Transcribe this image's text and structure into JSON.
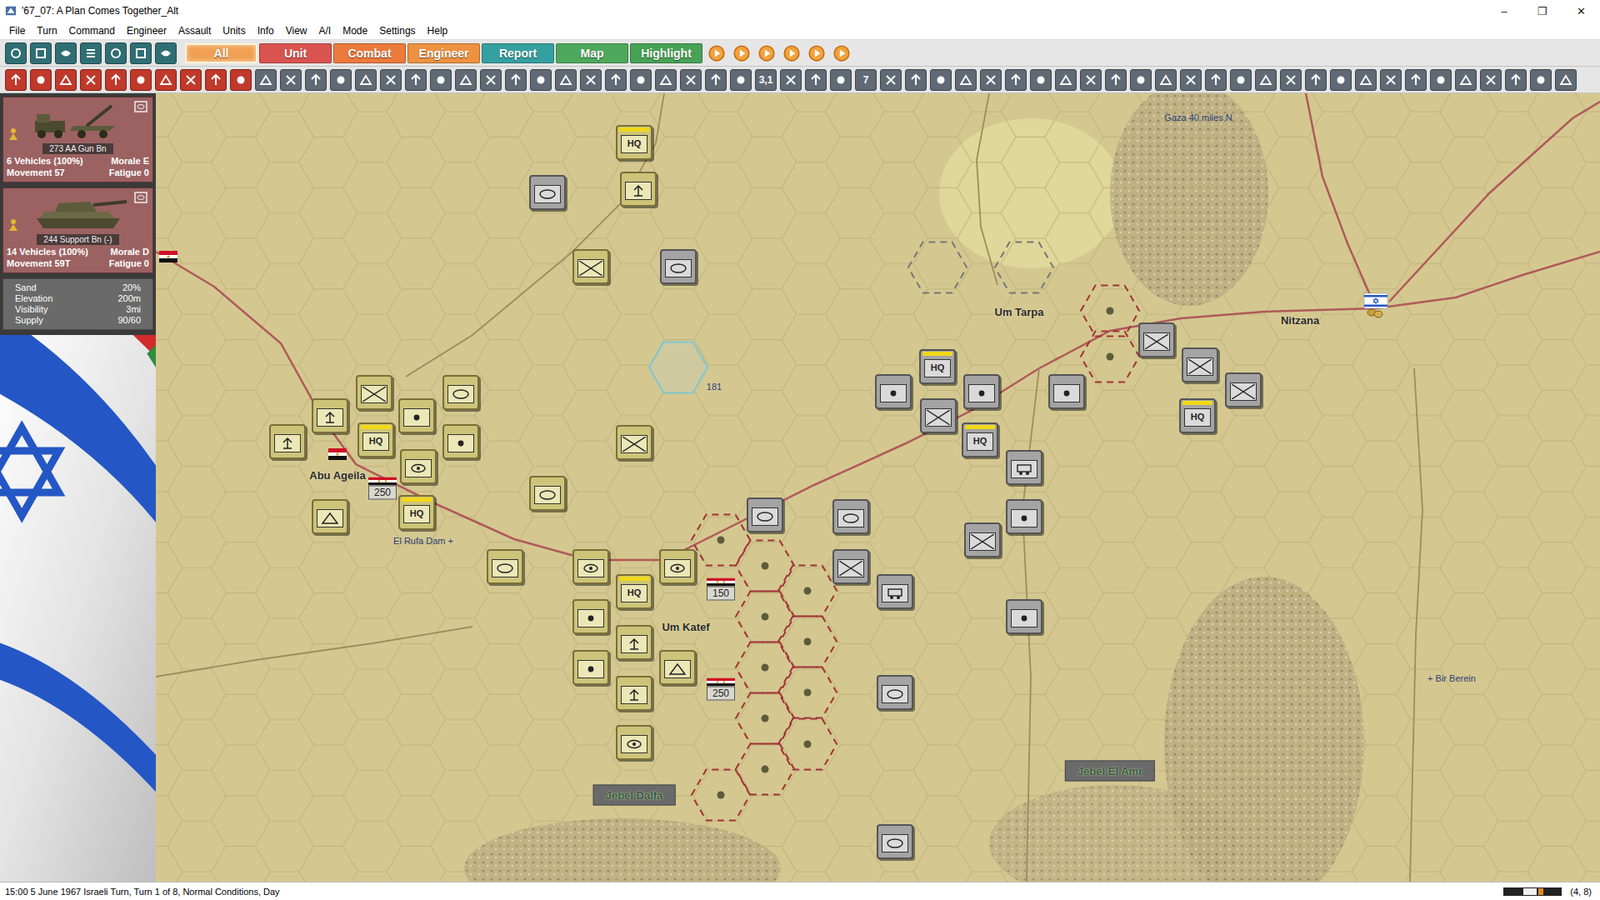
{
  "window": {
    "title": "'67_07: A Plan Comes Together_Alt",
    "controls": [
      "–",
      "❐",
      "✕"
    ]
  },
  "menu": [
    "File",
    "Turn",
    "Command",
    "Engineer",
    "Assault",
    "Units",
    "Info",
    "View",
    "A/I",
    "Mode",
    "Settings",
    "Help"
  ],
  "toolbar_top": {
    "icons": [
      {
        "kind": "icon"
      },
      {
        "kind": "icon"
      },
      {
        "kind": "icon"
      },
      {
        "kind": "icon"
      },
      {
        "kind": "icon"
      },
      {
        "kind": "icon"
      },
      {
        "kind": "icon"
      }
    ],
    "tabs": [
      {
        "label": "All",
        "selected": true,
        "color": "#f0a050"
      },
      {
        "label": "Unit",
        "selected": false,
        "color": "#d9534f"
      },
      {
        "label": "Combat",
        "selected": false,
        "color": "#ec7a3c"
      },
      {
        "label": "Engineer",
        "selected": false,
        "color": "#ee9240"
      },
      {
        "label": "Report",
        "selected": false,
        "color": "#35a0a0"
      },
      {
        "label": "Map",
        "selected": false,
        "color": "#4ea85c"
      },
      {
        "label": "Highlight",
        "selected": false,
        "color": "#47a256"
      }
    ],
    "playback": [
      {
        "kind": "icon"
      },
      {
        "kind": "icon"
      },
      {
        "kind": "icon"
      },
      {
        "kind": "icon"
      },
      {
        "kind": "icon"
      },
      {
        "kind": "icon"
      }
    ]
  },
  "toolbar_bottom": [
    {
      "kind": "icon"
    },
    {
      "kind": "icon"
    },
    {
      "kind": "icon"
    },
    {
      "kind": "icon"
    },
    {
      "kind": "icon"
    },
    {
      "kind": "icon"
    },
    {
      "kind": "icon"
    },
    {
      "kind": "icon"
    },
    {
      "kind": "icon"
    },
    {
      "kind": "icon"
    },
    {
      "kind": "icon"
    },
    {
      "kind": "icon"
    },
    {
      "kind": "icon"
    },
    {
      "kind": "icon"
    },
    {
      "kind": "icon"
    },
    {
      "kind": "icon"
    },
    {
      "kind": "icon"
    },
    {
      "kind": "icon"
    },
    {
      "kind": "icon"
    },
    {
      "kind": "icon"
    },
    {
      "kind": "icon"
    },
    {
      "kind": "icon"
    },
    {
      "kind": "icon"
    },
    {
      "kind": "icon"
    },
    {
      "kind": "icon"
    },
    {
      "kind": "icon"
    },
    {
      "kind": "icon"
    },
    {
      "kind": "icon"
    },
    {
      "kind": "icon"
    },
    {
      "kind": "icon"
    },
    {
      "kind": "text",
      "label": "3,1"
    },
    {
      "kind": "icon"
    },
    {
      "kind": "icon"
    },
    {
      "kind": "icon"
    },
    {
      "kind": "text",
      "label": "7"
    },
    {
      "kind": "icon"
    },
    {
      "kind": "icon"
    },
    {
      "kind": "icon"
    },
    {
      "kind": "icon"
    },
    {
      "kind": "icon"
    },
    {
      "kind": "icon"
    },
    {
      "kind": "icon"
    },
    {
      "kind": "icon"
    },
    {
      "kind": "icon"
    },
    {
      "kind": "icon"
    },
    {
      "kind": "icon"
    },
    {
      "kind": "icon"
    },
    {
      "kind": "icon"
    },
    {
      "kind": "icon"
    },
    {
      "kind": "icon"
    },
    {
      "kind": "icon"
    },
    {
      "kind": "icon"
    },
    {
      "kind": "icon"
    },
    {
      "kind": "icon"
    },
    {
      "kind": "icon"
    },
    {
      "kind": "icon"
    },
    {
      "kind": "icon"
    },
    {
      "kind": "icon"
    },
    {
      "kind": "icon"
    },
    {
      "kind": "icon"
    },
    {
      "kind": "icon"
    },
    {
      "kind": "icon"
    },
    {
      "kind": "icon"
    }
  ],
  "unit_cards": [
    {
      "kind": "gun",
      "name": "273 AA Gun Bn",
      "strength": "6 Vehicles (100%)",
      "morale": "Morale E",
      "movement": "Movement 57",
      "fatigue": "Fatigue 0"
    },
    {
      "kind": "tank",
      "name": "244 Support Bn (-)",
      "strength": "14 Vehicles (100%)",
      "morale": "Morale D",
      "movement": "Movement 59T",
      "fatigue": "Fatigue 0"
    }
  ],
  "terrain": [
    {
      "label": "Sand",
      "value": "20%"
    },
    {
      "label": "Elevation",
      "value": "200m"
    },
    {
      "label": "Visibility",
      "value": "3mi"
    },
    {
      "label": "Supply",
      "value": "90/60"
    }
  ],
  "map": {
    "labels": [
      {
        "text": "Gaza 40 miles N",
        "kind": "note"
      },
      {
        "text": "Um Tarpa",
        "kind": "place"
      },
      {
        "text": "Nitzana",
        "kind": "place"
      },
      {
        "text": "181",
        "kind": "note"
      },
      {
        "text": "Abu Ageila",
        "kind": "place"
      },
      {
        "text": "El Rufa Dam +",
        "kind": "note"
      },
      {
        "text": "Um Katef",
        "kind": "place"
      },
      {
        "text": "+ Bir Berein",
        "kind": "note"
      },
      {
        "text": "Jebel El Amr",
        "kind": "terrain"
      },
      {
        "text": "Jebel Dalfa",
        "kind": "terrain"
      }
    ],
    "counters": [
      {
        "kind": "hq",
        "side": "egyptian",
        "text": "HQ"
      },
      {
        "kind": "ordnance",
        "side": "egyptian"
      },
      {
        "kind": "infantry",
        "side": "egyptian"
      },
      {
        "kind": "infantry",
        "side": "egyptian"
      },
      {
        "kind": "infantry",
        "side": "egyptian"
      },
      {
        "kind": "ordnance",
        "side": "egyptian"
      },
      {
        "kind": "artillery",
        "side": "egyptian"
      },
      {
        "kind": "armor",
        "side": "egyptian"
      },
      {
        "kind": "ordnance",
        "side": "egyptian"
      },
      {
        "kind": "hq",
        "side": "egyptian",
        "text": "HQ"
      },
      {
        "kind": "artillery",
        "side": "egyptian"
      },
      {
        "kind": "antitank",
        "side": "egyptian"
      },
      {
        "kind": "engineer",
        "side": "egyptian"
      },
      {
        "kind": "hq",
        "side": "egyptian",
        "text": "HQ"
      },
      {
        "kind": "armor",
        "side": "egyptian"
      },
      {
        "kind": "armor",
        "side": "egyptian"
      },
      {
        "kind": "antitank",
        "side": "egyptian"
      },
      {
        "kind": "hq",
        "side": "egyptian",
        "text": "HQ"
      },
      {
        "kind": "antitank",
        "side": "egyptian"
      },
      {
        "kind": "artillery",
        "side": "egyptian"
      },
      {
        "kind": "ordnance",
        "side": "egyptian"
      },
      {
        "kind": "artillery",
        "side": "egyptian"
      },
      {
        "kind": "engineer",
        "side": "egyptian"
      },
      {
        "kind": "ordnance",
        "side": "egyptian"
      },
      {
        "kind": "antitank",
        "side": "egyptian"
      },
      {
        "kind": "armor",
        "side": "israeli"
      },
      {
        "kind": "armor",
        "side": "israeli"
      },
      {
        "kind": "artillery",
        "side": "israeli"
      },
      {
        "kind": "hq",
        "side": "israeli",
        "text": "HQ"
      },
      {
        "kind": "artillery",
        "side": "israeli"
      },
      {
        "kind": "infantry",
        "side": "israeli"
      },
      {
        "kind": "hq",
        "side": "israeli",
        "text": "HQ"
      },
      {
        "kind": "support",
        "side": "israeli"
      },
      {
        "kind": "artillery",
        "side": "israeli"
      },
      {
        "kind": "infantry",
        "side": "israeli"
      },
      {
        "kind": "artillery",
        "side": "israeli"
      },
      {
        "kind": "infantry",
        "side": "israeli"
      },
      {
        "kind": "infantry",
        "side": "israeli"
      },
      {
        "kind": "infantry",
        "side": "israeli"
      },
      {
        "kind": "hq",
        "side": "israeli",
        "text": "HQ"
      },
      {
        "kind": "armor",
        "side": "israeli"
      },
      {
        "kind": "armor",
        "side": "israeli"
      },
      {
        "kind": "infantry",
        "side": "israeli"
      },
      {
        "kind": "support",
        "side": "israeli"
      },
      {
        "kind": "artillery",
        "side": "israeli"
      },
      {
        "kind": "armor",
        "side": "israeli"
      },
      {
        "kind": "armor",
        "side": "israeli"
      }
    ],
    "badges": [
      {
        "text": "250"
      },
      {
        "text": "150"
      },
      {
        "text": "250"
      }
    ],
    "flags": [
      {
        "kind": "egyptian"
      },
      {
        "kind": "egyptian"
      },
      {
        "kind": "israeli"
      }
    ]
  },
  "status_bar": {
    "text": "15:00 5 June 1967 Israeli Turn, Turn 1 of 8, Normal Conditions, Day",
    "coords": "(4, 8)"
  }
}
